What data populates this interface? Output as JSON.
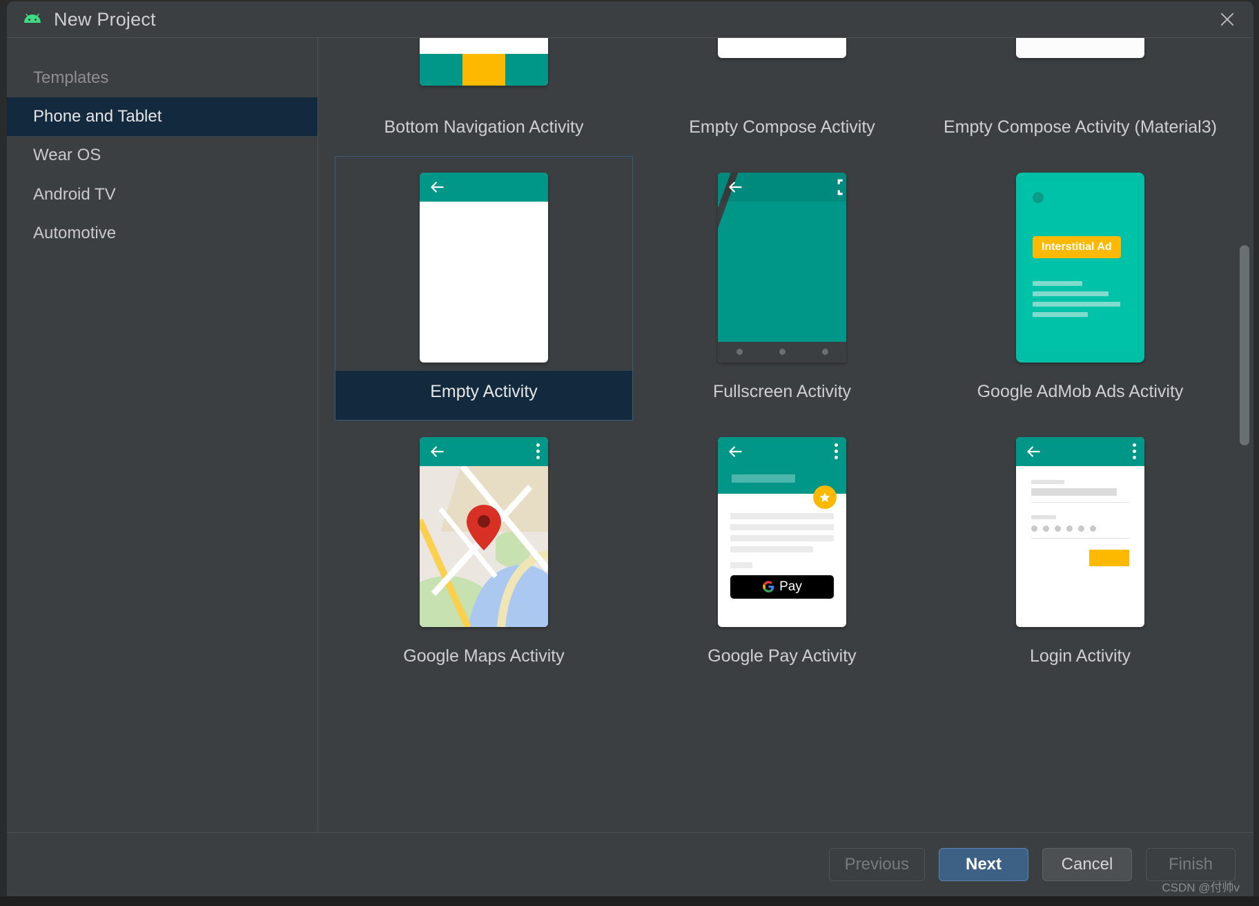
{
  "window": {
    "title": "New Project",
    "app_icon": "android-robot-icon",
    "close_icon": "close-icon"
  },
  "sidebar": {
    "header": "Templates",
    "items": [
      {
        "label": "Phone and Tablet",
        "selected": true
      },
      {
        "label": "Wear OS",
        "selected": false
      },
      {
        "label": "Android TV",
        "selected": false
      },
      {
        "label": "Automotive",
        "selected": false
      }
    ]
  },
  "templates": [
    {
      "label": "Bottom Navigation Activity",
      "thumb": "bottom-nav-thumb",
      "selected": false
    },
    {
      "label": "Empty Compose Activity",
      "thumb": "compose-logo-thumb",
      "selected": false
    },
    {
      "label": "Empty Compose Activity (Material3)",
      "thumb": "compose-logo-m3-thumb",
      "selected": false
    },
    {
      "label": "Empty Activity",
      "thumb": "empty-activity-thumb",
      "selected": true
    },
    {
      "label": "Fullscreen Activity",
      "thumb": "fullscreen-thumb",
      "selected": false
    },
    {
      "label": "Google AdMob Ads Activity",
      "thumb": "admob-thumb",
      "selected": false
    },
    {
      "label": "Google Maps Activity",
      "thumb": "maps-thumb",
      "selected": false
    },
    {
      "label": "Google Pay Activity",
      "thumb": "gpay-thumb",
      "selected": false
    },
    {
      "label": "Login Activity",
      "thumb": "login-thumb",
      "selected": false
    }
  ],
  "thumbnail_text": {
    "interstitial_ad": "Interstitial Ad",
    "gpay_label": "Pay"
  },
  "footer": {
    "previous": "Previous",
    "next": "Next",
    "cancel": "Cancel",
    "finish": "Finish"
  },
  "watermark": "CSDN @付帅v",
  "colors": {
    "dialog_bg": "#3c3f41",
    "selection_bg": "#13293d",
    "accent_teal": "#009688",
    "accent_yellow": "#fcb900",
    "primary_button": "#3d6185",
    "android_green": "#3ddc84"
  }
}
